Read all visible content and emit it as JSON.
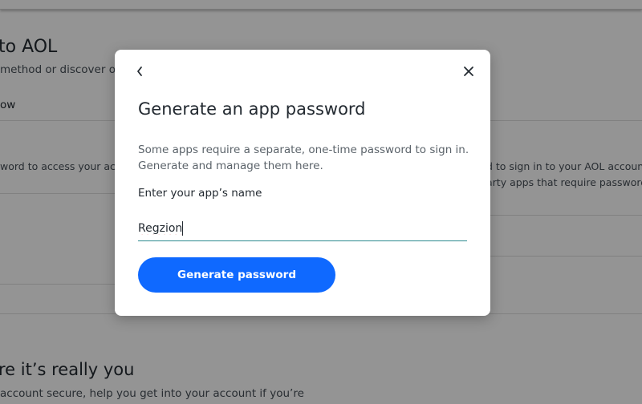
{
  "background": {
    "heading_1": "to AOL",
    "subtext_1": "method or discover ot",
    "link_1": "ow",
    "left_text": "word to access your accou",
    "right_text_1": "d to sign in to your AOL account,",
    "right_text_2": "arty apps that require passwords.",
    "heading_2": "re it’s really you",
    "subtext_2": "account secure, help you get into your account if you’re"
  },
  "modal": {
    "back_icon": "chevron-left-icon",
    "close_icon": "close-icon",
    "title": "Generate an app password",
    "description_line_1": "Some apps require a separate, one-time password to sign in.",
    "description_line_2": "Generate and manage them here.",
    "field_label": "Enter your app’s name",
    "field_value": "Regzion",
    "button_label": "Generate password"
  },
  "colors": {
    "primary_button": "#0f69ff",
    "field_underline": "#2b8a8f",
    "overlay": "rgba(0,0,0,0.42)",
    "text": "#232a31"
  }
}
